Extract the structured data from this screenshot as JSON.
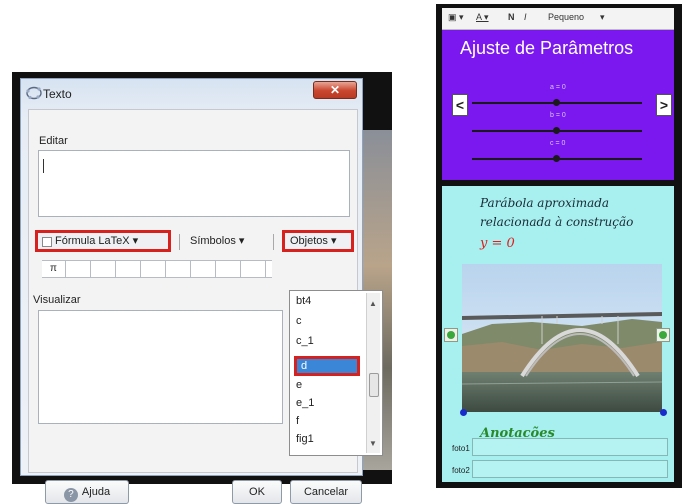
{
  "dialog": {
    "title": "Texto",
    "close_symbol": "✕",
    "editar_label": "Editar",
    "latex_label": "Fórmula LaTeX ▾",
    "simbolos_label": "Símbolos ▾",
    "objetos_label": "Objetos ▾",
    "symbol_cells": [
      "π",
      "",
      "",
      "",
      "",
      "",
      "",
      "",
      ""
    ],
    "visualizar_label": "Visualizar",
    "dropdown": {
      "items": [
        "bt4",
        "c",
        "c_1",
        "d",
        "e",
        "e_1",
        "f",
        "fig1"
      ],
      "selected": "d"
    },
    "buttons": {
      "help_glyph": "?",
      "ajuda": "Ajuda",
      "ok": "OK",
      "cancelar": "Cancelar"
    }
  },
  "applet": {
    "toolbar": {
      "box_icon": "▣ ▾",
      "color_icon": "A ▾",
      "bold": "N",
      "italic": "I",
      "size": "Pequeno",
      "size_arrow": "▾"
    },
    "params": {
      "title": "Ajuste de Parâmetros",
      "prev": "<",
      "next": ">",
      "sliders": [
        {
          "label": "a = 0",
          "value": 0
        },
        {
          "label": "b = 0",
          "value": 0
        },
        {
          "label": "c = 0",
          "value": 0
        }
      ]
    },
    "content": {
      "description": "Parábola aproximada relacionada à construção",
      "equation": "y = 0",
      "anotacoes": "Anotacões",
      "fields": [
        {
          "label": "foto1",
          "value": ""
        },
        {
          "label": "foto2",
          "value": ""
        }
      ]
    }
  },
  "colors": {
    "highlight_red": "#d6211e",
    "params_purple": "#7b18f0",
    "content_cyan": "#a8f0f0",
    "selection_blue": "#3b86d6",
    "equation_red": "#e11c1c",
    "anotacoes_green": "#2a8a2a"
  }
}
